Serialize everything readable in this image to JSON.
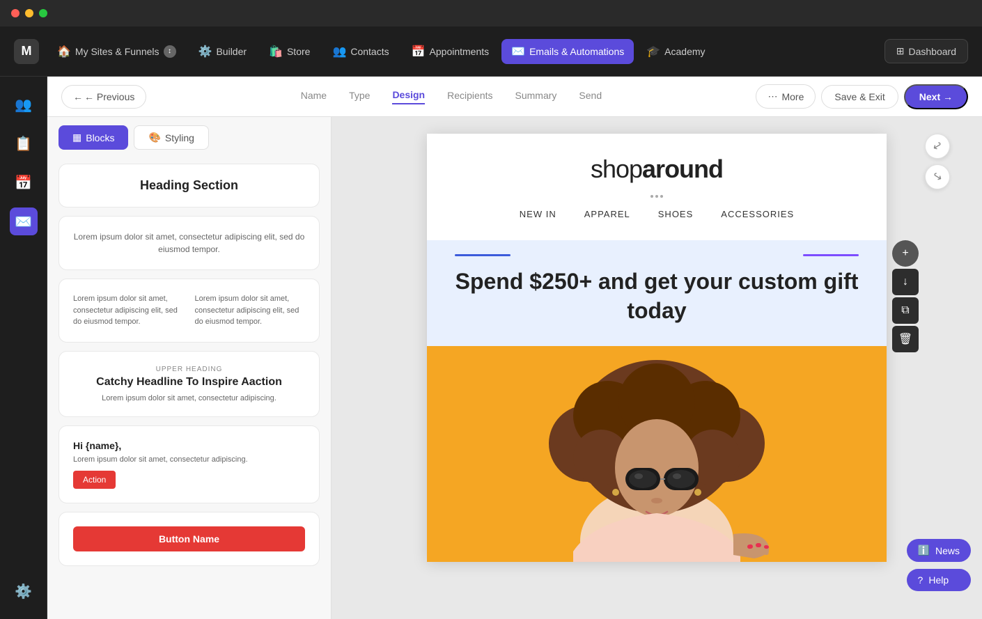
{
  "titlebar": {
    "controls": [
      "close",
      "minimize",
      "maximize"
    ]
  },
  "topnav": {
    "brand": "M",
    "items": [
      {
        "id": "sites",
        "label": "My Sites & Funnels",
        "icon": "🏠",
        "active": false,
        "has_badge": true
      },
      {
        "id": "builder",
        "label": "Builder",
        "icon": "⚙️",
        "active": false
      },
      {
        "id": "store",
        "label": "Store",
        "icon": "🛍️",
        "active": false
      },
      {
        "id": "contacts",
        "label": "Contacts",
        "icon": "👥",
        "active": false
      },
      {
        "id": "appointments",
        "label": "Appointments",
        "icon": "📅",
        "active": false
      },
      {
        "id": "emails",
        "label": "Emails & Automations",
        "icon": "✉️",
        "active": true
      },
      {
        "id": "academy",
        "label": "Academy",
        "icon": "🎓",
        "active": false
      }
    ],
    "dashboard_label": "Dashboard"
  },
  "sidebar_icons": [
    {
      "id": "contacts-icon",
      "icon": "👥",
      "active": false
    },
    {
      "id": "notes-icon",
      "icon": "📋",
      "active": false
    },
    {
      "id": "calendar-icon",
      "icon": "📅",
      "active": false
    },
    {
      "id": "email-icon",
      "icon": "✉️",
      "active": true
    },
    {
      "id": "settings-icon",
      "icon": "⚙️",
      "active": false
    }
  ],
  "toolbar": {
    "previous_label": "← Previous",
    "steps": [
      {
        "id": "name",
        "label": "Name",
        "active": false
      },
      {
        "id": "type",
        "label": "Type",
        "active": false
      },
      {
        "id": "design",
        "label": "Design",
        "active": true
      },
      {
        "id": "recipients",
        "label": "Recipients",
        "active": false
      },
      {
        "id": "summary",
        "label": "Summary",
        "active": false
      },
      {
        "id": "send",
        "label": "Send",
        "active": false
      }
    ],
    "more_label": "More",
    "save_exit_label": "Save & Exit",
    "next_label": "Next →"
  },
  "panel": {
    "tabs": [
      {
        "id": "blocks",
        "label": "Blocks",
        "icon": "▦",
        "active": true
      },
      {
        "id": "styling",
        "label": "Styling",
        "icon": "🎨",
        "active": false
      }
    ],
    "blocks": [
      {
        "id": "heading-section",
        "type": "heading",
        "title": "Heading Section"
      },
      {
        "id": "lorem-single",
        "type": "text",
        "text": "Lorem ipsum dolor sit amet, consectetur adipiscing elit, sed do eiusmod tempor."
      },
      {
        "id": "lorem-two-col",
        "type": "two-column",
        "col1": "Lorem ipsum dolor sit amet, consectetur adipiscing elit, sed do eiusmod tempor.",
        "col2": "Lorem ipsum dolor sit amet, consectetur adipiscing elit, sed do eiusmod tempor."
      },
      {
        "id": "catchy-headline",
        "type": "headline",
        "upper": "UPPER HEADING",
        "title": "Catchy Headline To Inspire Aaction",
        "sub": "Lorem ipsum dolor sit amet, consectetur adipiscing."
      },
      {
        "id": "personal-cta",
        "type": "personal",
        "greeting": "Hi {name},",
        "body": "Lorem ipsum dolor sit amet, consectetur adipiscing.",
        "button": "Action"
      },
      {
        "id": "button-block",
        "type": "button",
        "label": "Button Name"
      }
    ]
  },
  "email_preview": {
    "logo_text_light": "shop",
    "logo_text_bold": "around",
    "nav_items": [
      "NEW IN",
      "APPAREL",
      "SHOES",
      "ACCESSORIES"
    ],
    "promo_headline": "Spend $250+ and get your custom gift today",
    "image_alt": "Model with sunglasses on yellow background"
  },
  "float_toolbar": {
    "buttons": [
      {
        "id": "add-btn",
        "icon": "+"
      },
      {
        "id": "move-up-btn",
        "icon": "↑"
      },
      {
        "id": "copy-btn",
        "icon": "⧉"
      },
      {
        "id": "delete-btn",
        "icon": "🗑"
      }
    ]
  },
  "bottom_buttons": [
    {
      "id": "news",
      "label": "News",
      "icon": "ℹ️"
    },
    {
      "id": "help",
      "label": "Help",
      "icon": "?"
    }
  ]
}
